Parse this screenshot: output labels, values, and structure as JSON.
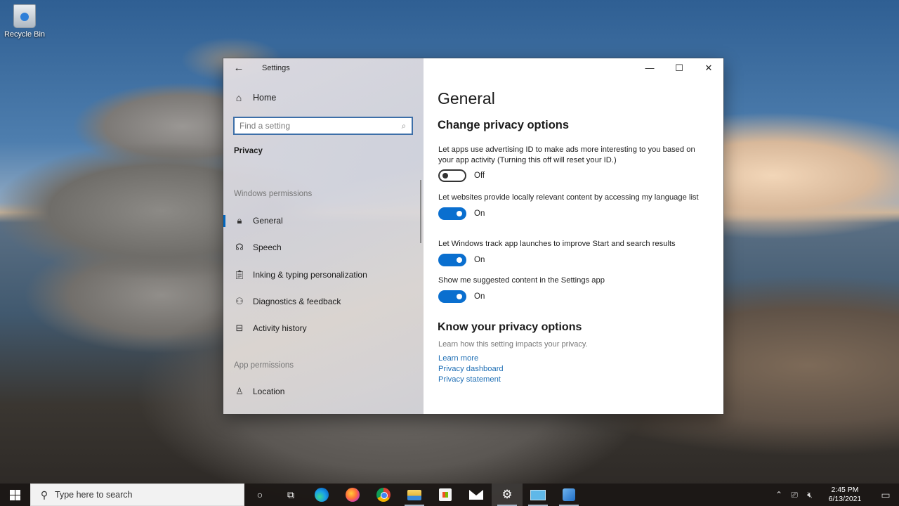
{
  "desktop": {
    "icons": [
      {
        "label": "Recycle Bin",
        "icon": "recycle-bin-icon"
      }
    ]
  },
  "window": {
    "app_title": "Settings",
    "back_icon": "←",
    "controls": {
      "minimize": "—",
      "maximize": "☐",
      "close": "✕"
    }
  },
  "nav": {
    "home": {
      "label": "Home",
      "icon": "⌂"
    },
    "search": {
      "placeholder": "Find a setting",
      "value": "",
      "icon": "⌕"
    },
    "section_title": "Privacy",
    "groups": [
      {
        "label": "Windows permissions",
        "items": [
          {
            "label": "General",
            "icon": "🔒︎",
            "active": true
          },
          {
            "label": "Speech",
            "icon": "☊"
          },
          {
            "label": "Inking & typing personalization",
            "icon": "📋︎"
          },
          {
            "label": "Diagnostics & feedback",
            "icon": "⚇"
          },
          {
            "label": "Activity history",
            "icon": "⊟"
          }
        ]
      },
      {
        "label": "App permissions",
        "items": [
          {
            "label": "Location",
            "icon": "♙"
          }
        ]
      }
    ]
  },
  "content": {
    "page_title": "General",
    "section_title": "Change privacy options",
    "settings": [
      {
        "description": "Let apps use advertising ID to make ads more interesting to you based on your app activity (Turning this off will reset your ID.)",
        "on": false,
        "state_label": "Off"
      },
      {
        "description": "Let websites provide locally relevant content by accessing my language list",
        "on": true,
        "state_label": "On"
      },
      {
        "description": "Let Windows track app launches to improve Start and search results",
        "on": true,
        "state_label": "On"
      },
      {
        "description": "Show me suggested content in the Settings app",
        "on": true,
        "state_label": "On"
      }
    ],
    "know": {
      "title": "Know your privacy options",
      "description": "Learn how this setting impacts your privacy.",
      "links": [
        "Learn more",
        "Privacy dashboard",
        "Privacy statement"
      ]
    }
  },
  "taskbar": {
    "search_placeholder": "Type here to search",
    "search_icon": "⚲",
    "cortana_icon": "○",
    "taskview_icon": "⧉",
    "apps": [
      {
        "name": "Microsoft Edge",
        "icon": "edge-icon",
        "running": false
      },
      {
        "name": "Firefox",
        "icon": "firefox-icon",
        "running": false
      },
      {
        "name": "Google Chrome",
        "icon": "chrome-icon",
        "running": false
      },
      {
        "name": "File Explorer",
        "icon": "file-explorer-icon",
        "running": true
      },
      {
        "name": "Microsoft Store",
        "icon": "store-icon",
        "running": false
      },
      {
        "name": "Mail",
        "icon": "mail-icon",
        "running": false
      },
      {
        "name": "Settings",
        "icon": "gear-icon",
        "running": true,
        "active": true
      },
      {
        "name": "Remote Desktop",
        "icon": "remote-desktop-icon",
        "running": true
      },
      {
        "name": "Visual Studio Installer",
        "icon": "vs-installer-icon",
        "running": true
      }
    ],
    "tray": {
      "chevron_icon": "⌃",
      "network_icon": "⎚",
      "volume_icon": "🔇︎",
      "time": "2:45 PM",
      "date": "6/13/2021",
      "notification_icon": "▭"
    }
  }
}
